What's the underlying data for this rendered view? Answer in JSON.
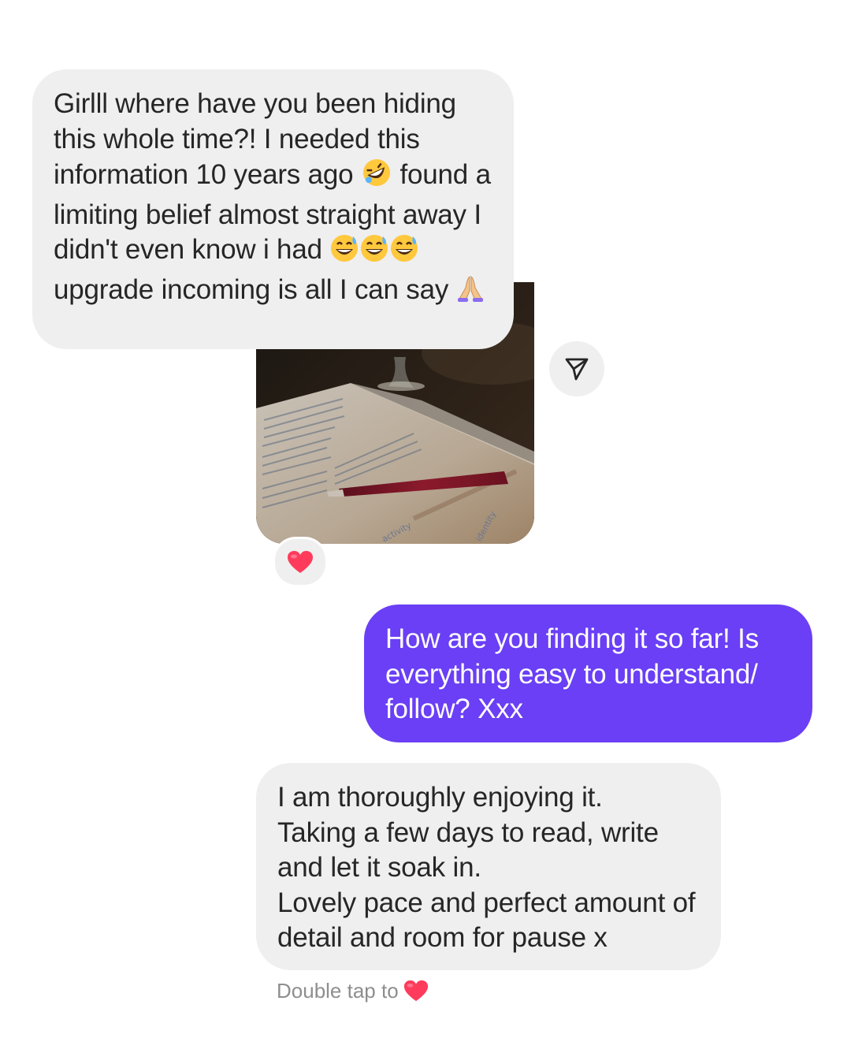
{
  "messages": [
    {
      "sender": "them",
      "text_before_emoji_1": "Girlll where have you been hiding this whole time?! I needed this information 10 years ago ",
      "emoji_1": "rolling-on-floor-laughing-icon",
      "text_middle": " found a limiting belief almost straight away I didn't even know i had ",
      "emoji_2": "grinning-sweat-icon",
      "emoji_2_count": 3,
      "text_after": " upgrade incoming is all I can say ",
      "emoji_3": "folded-hands-icon"
    },
    {
      "sender": "them",
      "type": "photo",
      "photo_text": [
        "activity",
        "identity"
      ],
      "reaction": "heart-icon"
    },
    {
      "sender": "me",
      "text": "How are you finding it so far! Is everything easy to understand/ follow? Xxx"
    },
    {
      "sender": "them",
      "text": "I am thoroughly enjoying it.\nTaking a few days to read, write and let it soak in.\nLovely pace and perfect amount of detail and room for pause x"
    }
  ],
  "double_tap_hint": "Double tap to",
  "hint_icon": "heart-icon",
  "colors": {
    "incoming_bg": "#efefef",
    "outgoing_bg": "#6a3ff5",
    "heart": "#ff3b5c",
    "hint_text": "#8e8e8e"
  }
}
